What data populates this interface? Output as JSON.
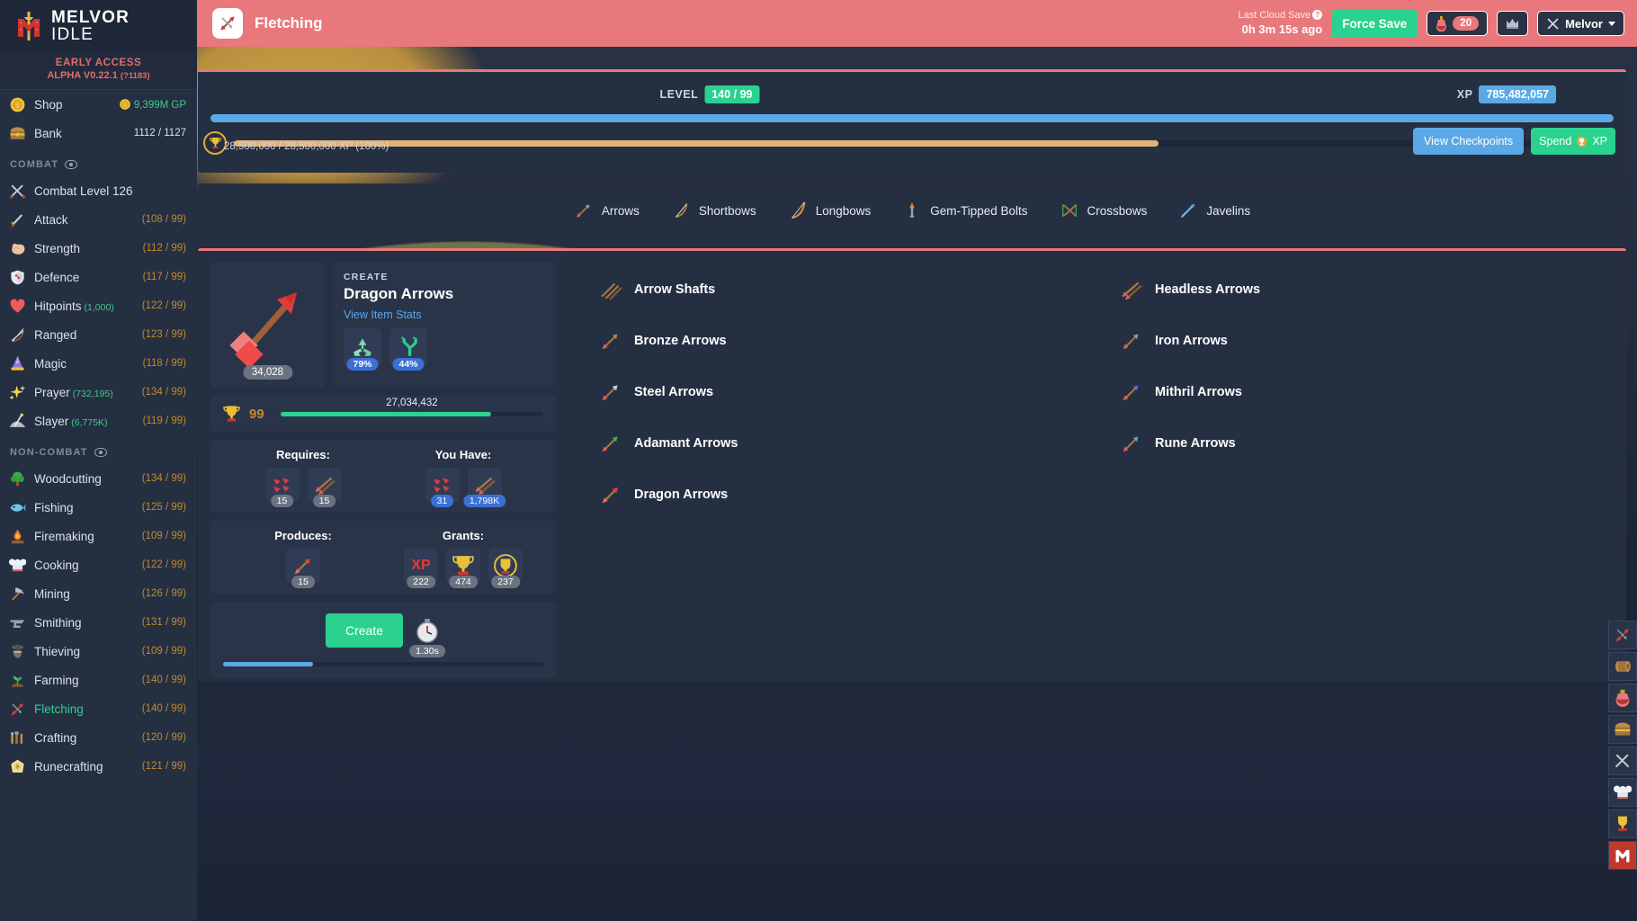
{
  "brand": {
    "line1": "MELVOR",
    "line2": "IDLE"
  },
  "version": {
    "early_access": "EARLY ACCESS",
    "alpha": "ALPHA V0.22.1",
    "build": "(?1183)"
  },
  "sidebar": {
    "top_items": [
      {
        "name": "Shop",
        "value": "9,399M GP",
        "icon": "coin-icon",
        "value_style": "gp"
      },
      {
        "name": "Bank",
        "value": "1112 / 1127",
        "icon": "chest-icon",
        "value_style": "plain"
      }
    ],
    "combat_header": "COMBAT",
    "combat_items": [
      {
        "name": "Combat Level 126",
        "value": "",
        "icon": "swords-icon"
      },
      {
        "name": "Attack",
        "value": "(108 / 99)",
        "icon": "sword-icon"
      },
      {
        "name": "Strength",
        "value": "(112 / 99)",
        "icon": "muscle-icon"
      },
      {
        "name": "Defence",
        "value": "(117 / 99)",
        "icon": "shield-icon"
      },
      {
        "name": "Hitpoints",
        "sub": "(1,000)",
        "value": "(122 / 99)",
        "icon": "heart-icon"
      },
      {
        "name": "Ranged",
        "value": "(123 / 99)",
        "icon": "bow-icon"
      },
      {
        "name": "Magic",
        "value": "(118 / 99)",
        "icon": "wizard-hat-icon"
      },
      {
        "name": "Prayer",
        "sub": "(732,195)",
        "value": "(134 / 99)",
        "icon": "sparkle-icon"
      },
      {
        "name": "Slayer",
        "sub": "(6,775K)",
        "value": "(119 / 99)",
        "icon": "slayer-icon"
      }
    ],
    "noncombat_header": "NON-COMBAT",
    "noncombat_items": [
      {
        "name": "Woodcutting",
        "value": "(134 / 99)",
        "icon": "tree-icon"
      },
      {
        "name": "Fishing",
        "value": "(125 / 99)",
        "icon": "fish-icon"
      },
      {
        "name": "Firemaking",
        "value": "(109 / 99)",
        "icon": "fire-icon"
      },
      {
        "name": "Cooking",
        "value": "(122 / 99)",
        "icon": "chef-hat-icon"
      },
      {
        "name": "Mining",
        "value": "(126 / 99)",
        "icon": "pickaxe-icon"
      },
      {
        "name": "Smithing",
        "value": "(131 / 99)",
        "icon": "anvil-icon"
      },
      {
        "name": "Thieving",
        "value": "(109 / 99)",
        "icon": "thief-icon"
      },
      {
        "name": "Farming",
        "value": "(140 / 99)",
        "icon": "seedling-icon"
      },
      {
        "name": "Fletching",
        "value": "(140 / 99)",
        "icon": "fletching-icon",
        "active": true
      },
      {
        "name": "Crafting",
        "value": "(120 / 99)",
        "icon": "crafting-icon"
      },
      {
        "name": "Runecrafting",
        "value": "(121 / 99)",
        "icon": "runecrafting-icon"
      }
    ]
  },
  "header": {
    "title": "Fletching",
    "title_icon": "fletching-icon",
    "cloud_save_label": "Last Cloud Save",
    "cloud_save_time": "0h 3m 15s ago",
    "force_save_label": "Force Save",
    "potion_count": "20",
    "potion_icon": "potion-icon",
    "crown_icon": "crown-icon",
    "account_name": "Melvor",
    "account_icon": "swords-icon"
  },
  "level_panel": {
    "level_label": "LEVEL",
    "level_value": "140 / 99",
    "xp_label": "XP",
    "xp_value": "785,482,057",
    "xp_percent": 100,
    "mastery_text": "28,500,000 / 28,500,000 XP (100%)",
    "mastery_percent": 67,
    "view_checkpoints_label": "View Checkpoints",
    "spend_label": "Spend",
    "spend_suffix": "XP",
    "trophy_icon": "trophy-icon"
  },
  "categories": [
    {
      "label": "Arrows",
      "icon": "arrow-icon",
      "active": true
    },
    {
      "label": "Shortbows",
      "icon": "shortbow-icon"
    },
    {
      "label": "Longbows",
      "icon": "longbow-icon"
    },
    {
      "label": "Gem-Tipped Bolts",
      "icon": "bolt-icon"
    },
    {
      "label": "Crossbows",
      "icon": "crossbow-icon"
    },
    {
      "label": "Javelins",
      "icon": "javelin-icon"
    }
  ],
  "selected_item": {
    "kicker": "CREATE",
    "name": "Dragon Arrows",
    "view_stats_label": "View Item Stats",
    "owned_qty": "34,028",
    "item_icon": "dragon-arrow-icon",
    "modifiers": [
      {
        "icon": "recycle-icon",
        "value": "79%"
      },
      {
        "icon": "fork-icon",
        "value": "44%"
      }
    ],
    "mastery": {
      "icon": "trophy-icon",
      "level": "99",
      "xp": "27,034,432",
      "percent": 80
    },
    "requires_title": "Requires:",
    "requires": [
      {
        "icon": "dragon-arrowtips-icon",
        "qty": "15"
      },
      {
        "icon": "headless-arrow-icon",
        "qty": "15"
      }
    ],
    "you_have_title": "You Have:",
    "you_have": [
      {
        "icon": "dragon-arrowtips-icon",
        "qty": "31"
      },
      {
        "icon": "headless-arrow-icon",
        "qty": "1,798K"
      }
    ],
    "produces_title": "Produces:",
    "produces": [
      {
        "icon": "dragon-arrow-icon",
        "qty": "15"
      }
    ],
    "grants_title": "Grants:",
    "grants": [
      {
        "icon": "xp-icon",
        "qty": "222"
      },
      {
        "icon": "trophy-gold-icon",
        "qty": "474"
      },
      {
        "icon": "trophy-pool-icon",
        "qty": "237"
      }
    ],
    "create_label": "Create",
    "interval": "1.30s",
    "timer_icon": "stopwatch-icon",
    "progress_percent": 28
  },
  "recipes": [
    {
      "label": "Arrow Shafts",
      "icon": "arrow-shafts-icon"
    },
    {
      "label": "Headless Arrows",
      "icon": "headless-arrow-icon"
    },
    {
      "label": "Bronze Arrows",
      "icon": "bronze-arrow-icon"
    },
    {
      "label": "Iron Arrows",
      "icon": "iron-arrow-icon"
    },
    {
      "label": "Steel Arrows",
      "icon": "steel-arrow-icon"
    },
    {
      "label": "Mithril Arrows",
      "icon": "mithril-arrow-icon"
    },
    {
      "label": "Adamant Arrows",
      "icon": "adamant-arrow-icon"
    },
    {
      "label": "Rune Arrows",
      "icon": "rune-arrow-icon"
    },
    {
      "label": "Dragon Arrows",
      "icon": "dragon-arrow-icon"
    }
  ],
  "dock": [
    {
      "icon": "fletching-icon"
    },
    {
      "icon": "log-icon"
    },
    {
      "icon": "potion-icon"
    },
    {
      "icon": "bank-icon"
    },
    {
      "icon": "combat-icon"
    },
    {
      "icon": "cooking-icon"
    },
    {
      "icon": "trophy-icon"
    },
    {
      "icon": "melvor-icon"
    }
  ],
  "colors": {
    "accent_red": "#e8787c",
    "green": "#2bd18f",
    "blue": "#5aa9e6",
    "gold": "#c08a2e",
    "panel": "#252f42",
    "card": "#2a3449"
  }
}
